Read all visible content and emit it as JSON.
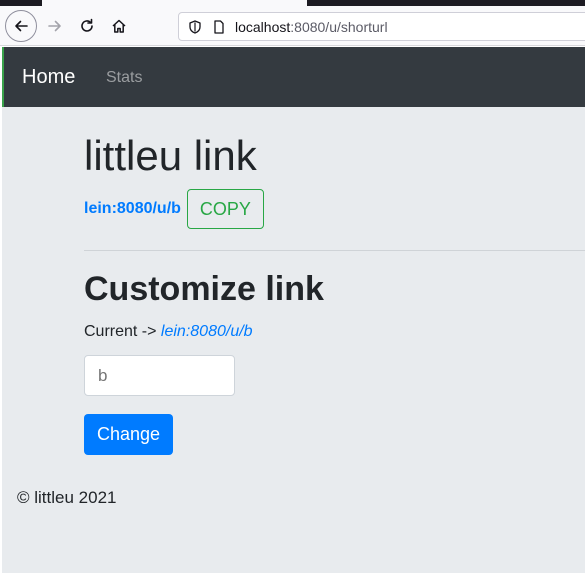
{
  "browser": {
    "url_host": "localhost",
    "url_rest": ":8080/u/shorturl"
  },
  "navbar": {
    "brand": "Home",
    "links": [
      "Stats"
    ]
  },
  "main": {
    "title": "littleu link",
    "short_link": "lein:8080/u/b",
    "copy_label": "COPY",
    "subtitle": "Customize link",
    "current_prefix": "Current -> ",
    "current_link": "lein:8080/u/b",
    "input_placeholder": "b",
    "change_label": "Change"
  },
  "footer": {
    "text": "© littleu 2021"
  },
  "colors": {
    "navbar_bg": "#343a40",
    "primary": "#007bff",
    "success": "#28a745",
    "page_bg": "#e8ebee"
  }
}
